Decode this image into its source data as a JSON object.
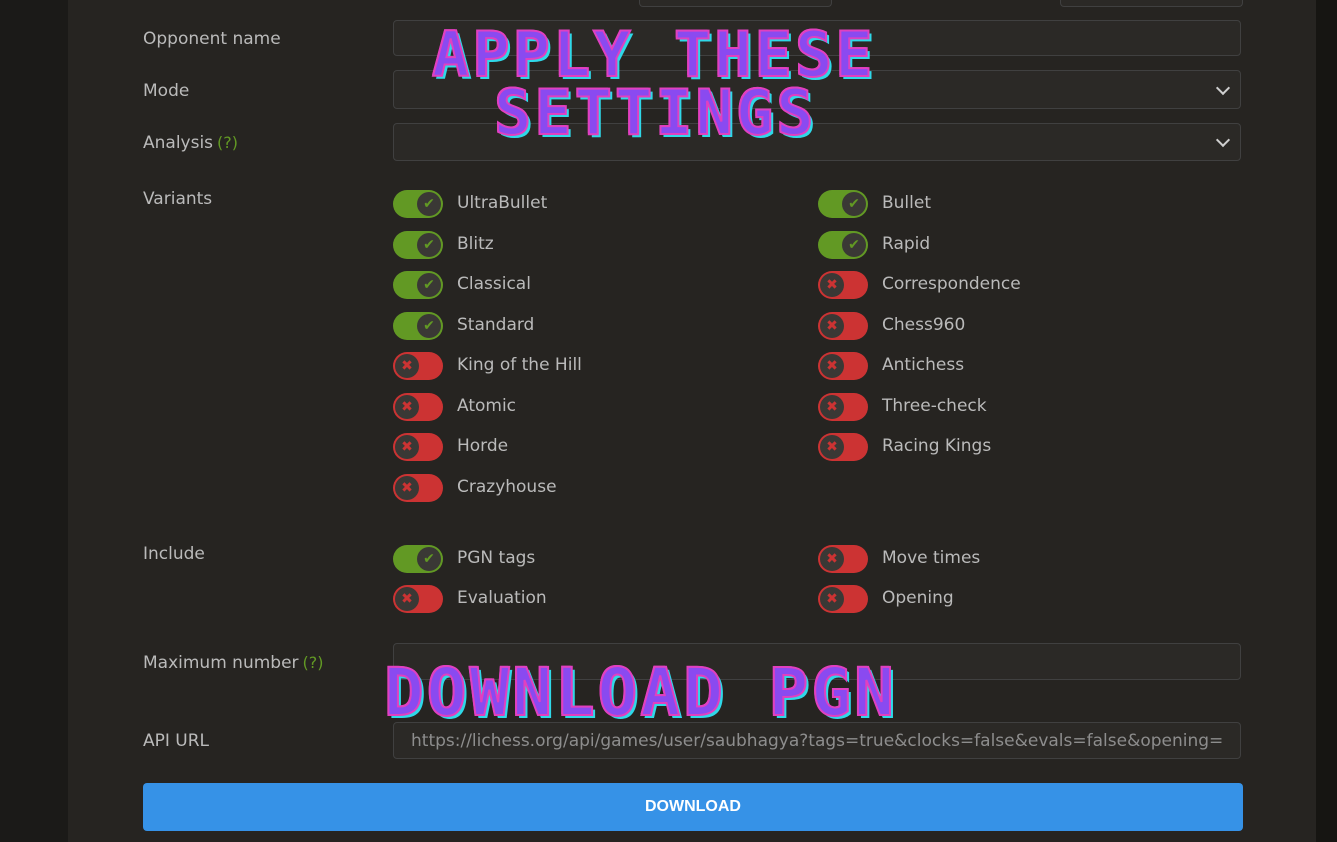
{
  "form": {
    "opponent_label": "Opponent name",
    "opponent_value": "",
    "mode_label": "Mode",
    "mode_value": "",
    "analysis_label": "Analysis",
    "analysis_help": "(?)",
    "analysis_value": "",
    "variants_label": "Variants",
    "variants": [
      {
        "label": "UltraBullet",
        "on": true
      },
      {
        "label": "Bullet",
        "on": true
      },
      {
        "label": "Blitz",
        "on": true
      },
      {
        "label": "Rapid",
        "on": true
      },
      {
        "label": "Classical",
        "on": true
      },
      {
        "label": "Correspondence",
        "on": false
      },
      {
        "label": "Standard",
        "on": true
      },
      {
        "label": "Chess960",
        "on": false
      },
      {
        "label": "King of the Hill",
        "on": false
      },
      {
        "label": "Antichess",
        "on": false
      },
      {
        "label": "Atomic",
        "on": false
      },
      {
        "label": "Three-check",
        "on": false
      },
      {
        "label": "Horde",
        "on": false
      },
      {
        "label": "Racing Kings",
        "on": false
      },
      {
        "label": "Crazyhouse",
        "on": false
      }
    ],
    "include_label": "Include",
    "include": [
      {
        "label": "PGN tags",
        "on": true
      },
      {
        "label": "Move times",
        "on": false
      },
      {
        "label": "Evaluation",
        "on": false
      },
      {
        "label": "Opening",
        "on": false
      }
    ],
    "max_label": "Maximum number",
    "max_help": "(?)",
    "max_value": "",
    "api_label": "API URL",
    "api_url": "https://lichess.org/api/games/user/saubhagya?tags=true&clocks=false&evals=false&opening=false",
    "download_label": "DOWNLOAD"
  },
  "overlays": {
    "apply_line1": "APPLY THESE",
    "apply_line2": "SETTINGS",
    "download_pgn": "DOWNLOAD PGN"
  },
  "colors": {
    "toggle_on": "#629924",
    "toggle_off": "#cc3333",
    "button": "#3692e7",
    "overlay_fill": "#8a4af0",
    "overlay_outline": "#2fd8e8"
  },
  "icons": {
    "on": "check-icon",
    "off": "cross-icon",
    "select": "chevron-down-icon"
  }
}
